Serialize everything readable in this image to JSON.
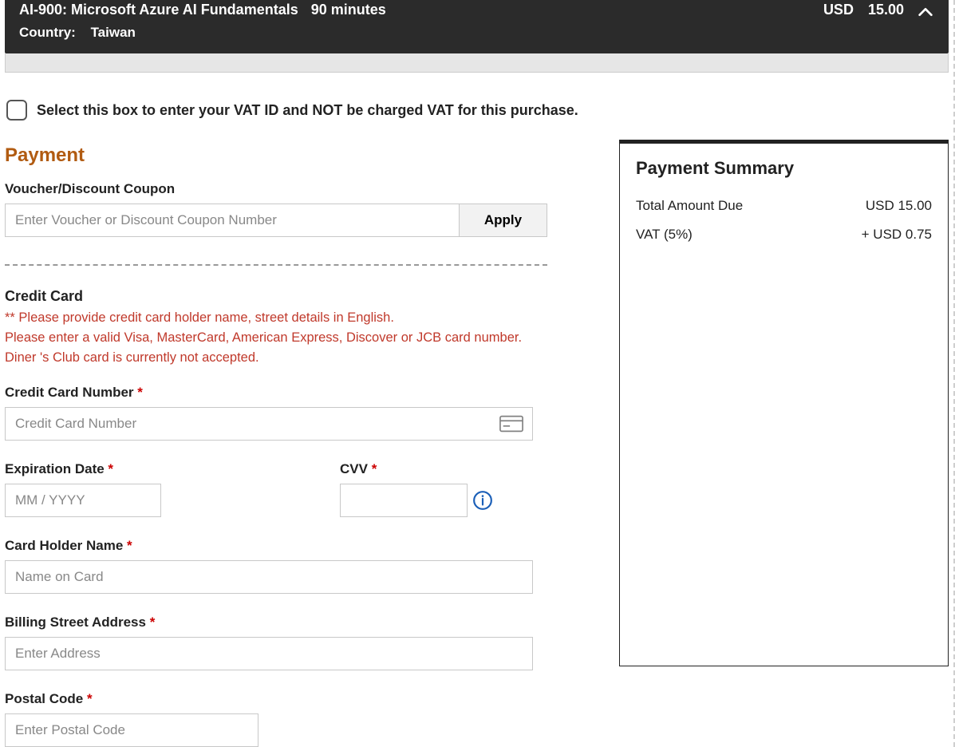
{
  "exam": {
    "title": "AI-900: Microsoft Azure AI Fundamentals",
    "duration": "90 minutes",
    "currency": "USD",
    "price": "15.00",
    "country_label": "Country:",
    "country": "Taiwan"
  },
  "vat_checkbox_text": "Select this box to enter your VAT ID and NOT be charged VAT for this purchase.",
  "payment_heading": "Payment",
  "voucher": {
    "label": "Voucher/Discount Coupon",
    "placeholder": "Enter Voucher or Discount Coupon Number",
    "apply_label": "Apply"
  },
  "credit_card": {
    "section_title": "Credit Card",
    "note1": "** Please provide credit card holder name, street details in English.",
    "note2": "Please enter a valid Visa, MasterCard, American Express, Discover or JCB card number.",
    "note3": "Diner 's Club card is currently not accepted.",
    "number_label": "Credit Card Number",
    "number_placeholder": "Credit Card Number",
    "exp_label": "Expiration Date",
    "exp_placeholder": "MM / YYYY",
    "cvv_label": "CVV",
    "holder_label": "Card Holder Name",
    "holder_placeholder": "Name on Card",
    "addr_label": "Billing Street Address",
    "addr_placeholder": "Enter Address",
    "postal_label": "Postal Code",
    "postal_placeholder": "Enter Postal Code"
  },
  "summary": {
    "title": "Payment Summary",
    "total_label": "Total Amount Due",
    "total_value": "USD 15.00",
    "vat_label": "VAT (5%)",
    "vat_value": "+ USD 0.75"
  },
  "required_mark": " *"
}
